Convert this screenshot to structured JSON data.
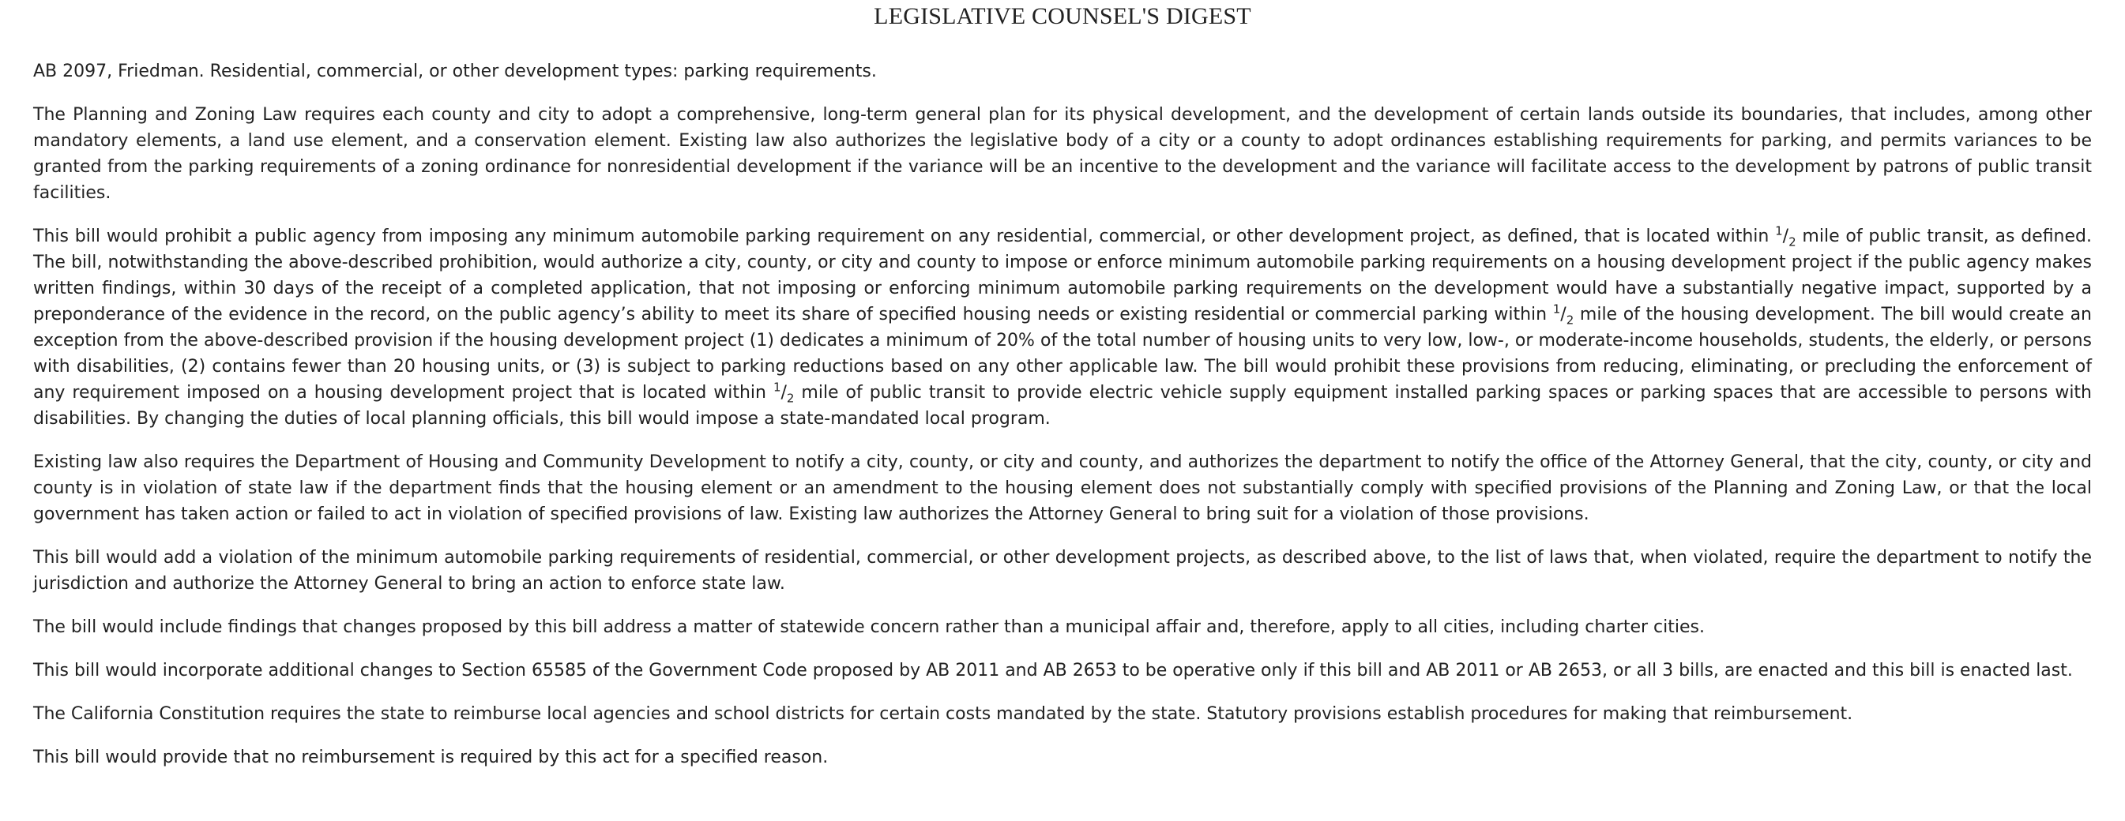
{
  "document": {
    "title": "LEGISLATIVE COUNSEL'S DIGEST",
    "heading": "AB 2097, Friedman. Residential, commercial, or other development types: parking requirements.",
    "paragraphs": {
      "p1": "The Planning and Zoning Law requires each county and city to adopt a comprehensive, long-term general plan for its physical development, and the development of certain lands outside its boundaries, that includes, among other mandatory elements, a land use element, and a conservation element. Existing law also authorizes the legislative body of a city or a county to adopt ordinances establishing requirements for parking, and permits variances to be granted from the parking requirements of a zoning ordinance for nonresidential development if the variance will be an incentive to the development and the variance will facilitate access to the development by patrons of public transit facilities.",
      "p2": {
        "a": "This bill would prohibit a public agency from imposing any minimum automobile parking requirement on any residential, commercial, or other development project, as defined, that is located within ",
        "b": " mile of public transit, as defined. The bill, notwithstanding the above-described prohibition, would authorize a city, county, or city and county to impose or enforce minimum automobile parking requirements on a housing development project if the public agency makes written findings, within 30 days of the receipt of a completed application, that not imposing or enforcing minimum automobile parking requirements on the development would have a substantially negative impact, supported by a preponderance of the evidence in the record, on the public agency’s ability to meet its share of specified housing needs or existing residential or commercial parking within ",
        "c": " mile of the housing development. The bill would create an exception from the above-described provision if the housing development project (1) dedicates a minimum of 20% of the total number of housing units to very low, low-, or moderate-income households, students, the elderly, or persons with disabilities, (2) contains fewer than 20 housing units, or (3) is subject to parking reductions based on any other applicable law. The bill would prohibit these provisions from reducing, eliminating, or precluding the enforcement of any requirement imposed on a housing development project that is located within ",
        "d": " mile of public transit to provide electric vehicle supply equipment installed parking spaces or parking spaces that are accessible to persons with disabilities. By changing the duties of local planning officials, this bill would impose a state-mandated local program.",
        "frac_num": "1",
        "frac_sep": "/",
        "frac_den": "2"
      },
      "p3": "Existing law also requires the Department of Housing and Community Development to notify a city, county, or city and county, and authorizes the department to notify the office of the Attorney General, that the city, county, or city and county is in violation of state law if the department finds that the housing element or an amendment to the housing element does not substantially comply with specified provisions of the Planning and Zoning Law, or that the local government has taken action or failed to act in violation of specified provisions of law. Existing law authorizes the Attorney General to bring suit for a violation of those provisions.",
      "p4": "This bill would add a violation of the minimum automobile parking requirements of residential, commercial, or other development projects, as described above, to the list of laws that, when violated, require the department to notify the jurisdiction and authorize the Attorney General to bring an action to enforce state law.",
      "p5": "The bill would include findings that changes proposed by this bill address a matter of statewide concern rather than a municipal affair and, therefore, apply to all cities, including charter cities.",
      "p6": "This bill would incorporate additional changes to Section 65585 of the Government Code proposed by AB 2011 and AB 2653 to be operative only if this bill and AB 2011 or AB 2653, or all 3 bills, are enacted and this bill is enacted last.",
      "p7": "The California Constitution requires the state to reimburse local agencies and school districts for certain costs mandated by the state. Statutory provisions establish procedures for making that reimbursement.",
      "p8": "This bill would provide that no reimbursement is required by this act for a specified reason."
    }
  }
}
